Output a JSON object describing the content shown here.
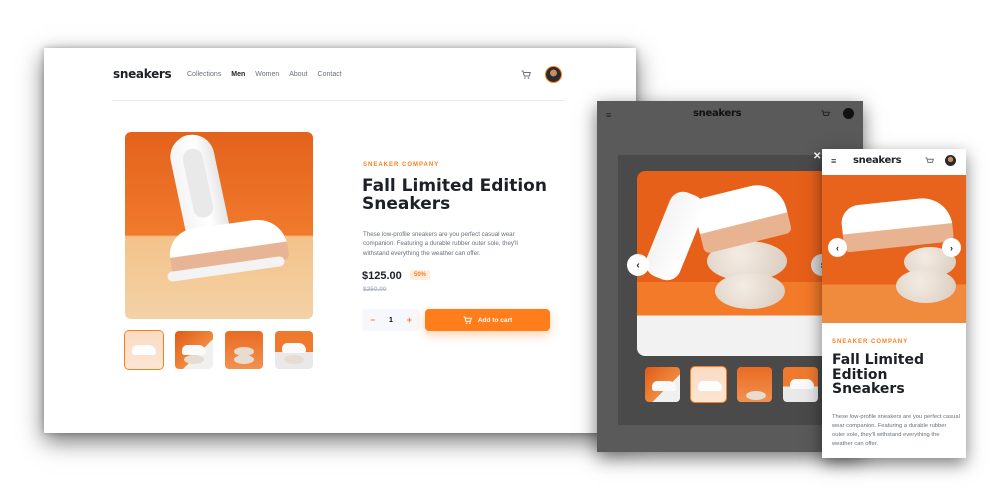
{
  "brand": "sneakers",
  "nav": {
    "items": [
      "Collections",
      "Men",
      "Women",
      "About",
      "Contact"
    ],
    "active": "Men"
  },
  "product": {
    "company": "SNEAKER COMPANY",
    "title": "Fall Limited Edition Sneakers",
    "description": "These low-profile sneakers are you perfect casual wear companion. Featuring a durable rubber outer sole, they'll withstand everything the weather can offer.",
    "price": "$125.00",
    "discount": "50%",
    "old_price": "$250.00",
    "quantity": "1",
    "add_to_cart": "Add to cart"
  },
  "icons": {
    "menu": "menu-icon",
    "cart": "cart-icon",
    "close": "close-icon",
    "prev": "chevron-left-icon",
    "next": "chevron-right-icon",
    "minus": "minus-icon",
    "plus": "plus-icon"
  },
  "glyphs": {
    "menu": "≡",
    "close": "✕",
    "prev": "‹",
    "next": "›",
    "minus": "−",
    "plus": "+"
  },
  "colors": {
    "accent": "#ff7e1b",
    "accent_light": "#ffede0",
    "dark": "#1d2026",
    "muted": "#69707d",
    "overlay": "#5a5a5a"
  }
}
